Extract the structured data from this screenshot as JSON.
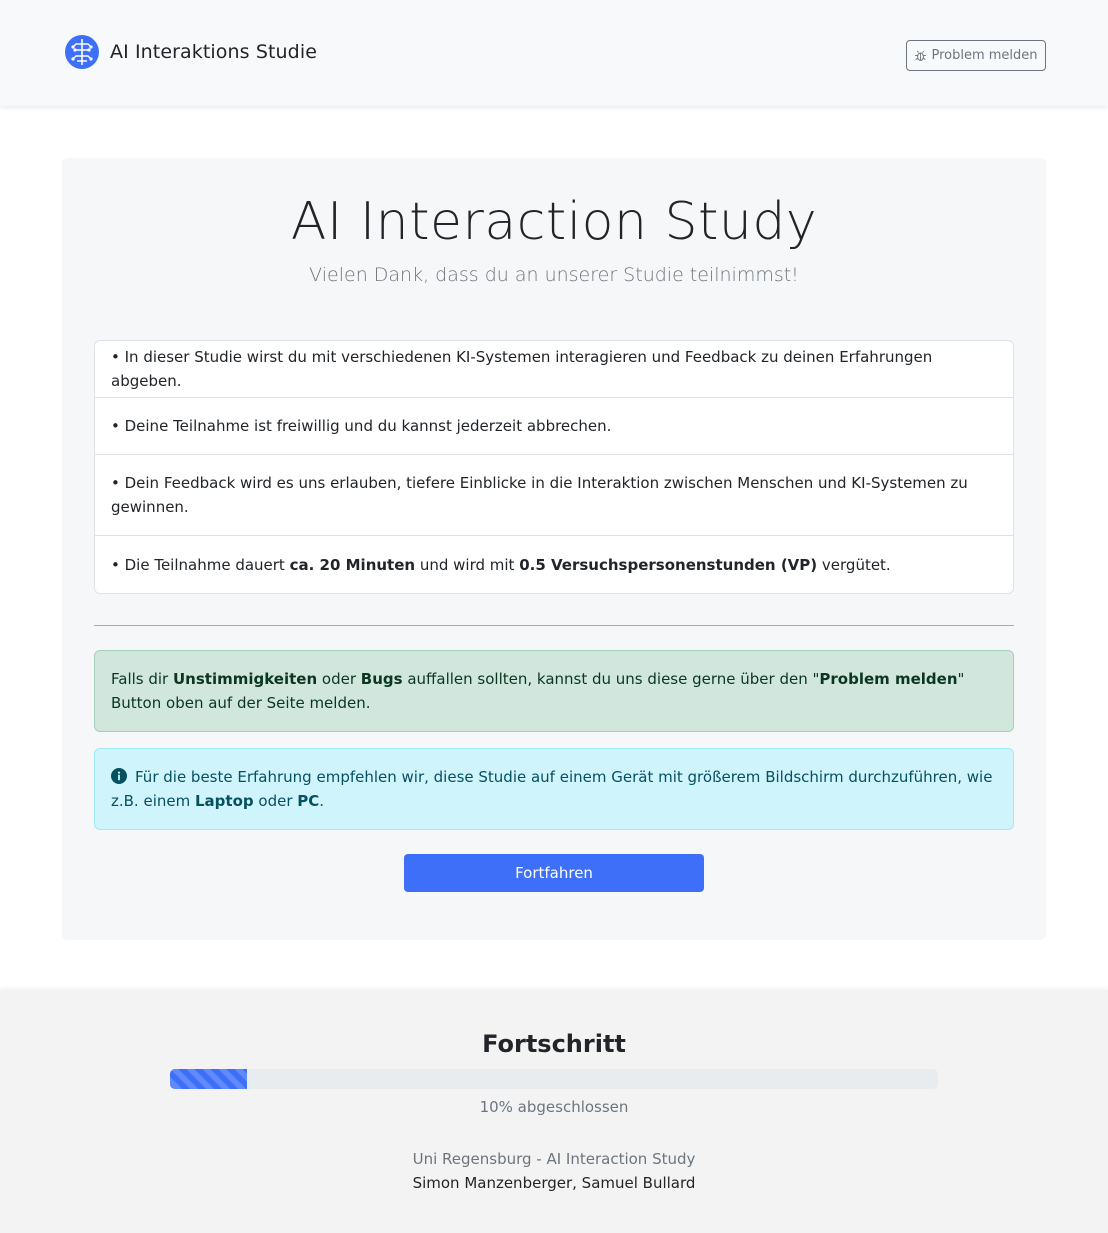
{
  "colors": {
    "primary": "#3d6ff8",
    "success_bg": "#d1e7dd",
    "info_bg": "#cff4fc",
    "secondary": "#6c757d"
  },
  "header": {
    "brand_icon": "brain-icon",
    "brand_title": "AI Interaktions Studie",
    "report_icon": "bug-icon",
    "report_label": "Problem melden"
  },
  "main": {
    "title": "AI Interaction Study",
    "subtitle": "Vielen Dank, dass du an unserer Studie teilnimmst!",
    "items": [
      {
        "text": "• In dieser Studie wirst du mit verschiedenen KI-Systemen interagieren und Feedback zu deinen Erfahrungen abgeben."
      },
      {
        "text": "• Deine Teilnahme ist freiwillig und du kannst jederzeit abbrechen."
      },
      {
        "text": "• Dein Feedback wird es uns erlauben, tiefere Einblicke in die Interaktion zwischen Menschen und KI-Systemen zu gewinnen."
      },
      {
        "part1": "• Die Teilnahme dauert ",
        "strong1": "ca. 20 Minuten",
        "part2": " und wird mit ",
        "strong2": "0.5 Versuchspersonenstunden (VP)",
        "part3": " vergütet."
      }
    ],
    "bug_alert": {
      "t1": "Falls dir ",
      "b1": "Unstimmigkeiten",
      "t2": " oder ",
      "b2": "Bugs",
      "t3": " auffallen sollten, kannst du uns diese gerne über den \"",
      "b3": "Problem melden",
      "t4": "\" Button oben auf der Seite melden."
    },
    "device_alert": {
      "icon": "info-circle-icon",
      "t1": "Für die beste Erfahrung empfehlen wir, diese Studie auf einem Gerät mit größerem Bildschirm durchzuführen, wie z.B. einem ",
      "b1": "Laptop",
      "t2": " oder ",
      "b2": "PC",
      "t3": "."
    },
    "continue_label": "Fortfahren"
  },
  "footer": {
    "progress_title": "Fortschritt",
    "progress_value": 10,
    "progress_text": "10% abgeschlossen",
    "line1": "Uni Regensburg - AI Interaction Study",
    "line2": "Simon Manzenberger, Samuel Bullard"
  }
}
